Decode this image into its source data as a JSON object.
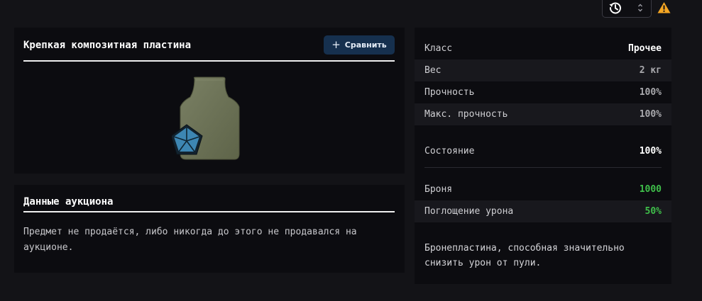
{
  "topbar": {
    "history_icon": "history-clock-icon",
    "sort_icon": "chevron-up-down-icon",
    "warning_icon": "warning-triangle-icon",
    "warning_color": "#f5a623"
  },
  "item": {
    "title": "Крепкая композитная пластина",
    "compare_label": "Сравнить",
    "compare_icon": "plus-icon",
    "image_icon": "armor-plate-icon",
    "plate_color": "#6e7458",
    "badge_color": "#3d86b3"
  },
  "auction": {
    "title": "Данные аукциона",
    "text": "Предмет не продаётся, либо никогда до этого не продавался на аукционе."
  },
  "stats": {
    "rows": [
      {
        "label": "Класс",
        "value": "Прочее"
      },
      {
        "label": "Вес",
        "value": "2 кг"
      },
      {
        "label": "Прочность",
        "value": "100%"
      },
      {
        "label": "Макс. прочность",
        "value": "100%"
      }
    ],
    "condition": {
      "label": "Состояние",
      "value": "100%"
    },
    "armor": [
      {
        "label": "Броня",
        "value": "1000"
      },
      {
        "label": "Поглощение урона",
        "value": "50%"
      }
    ],
    "accent_green": "#3fbf4a",
    "description": "Бронепластина, способная значительно снизить урон от пули."
  }
}
